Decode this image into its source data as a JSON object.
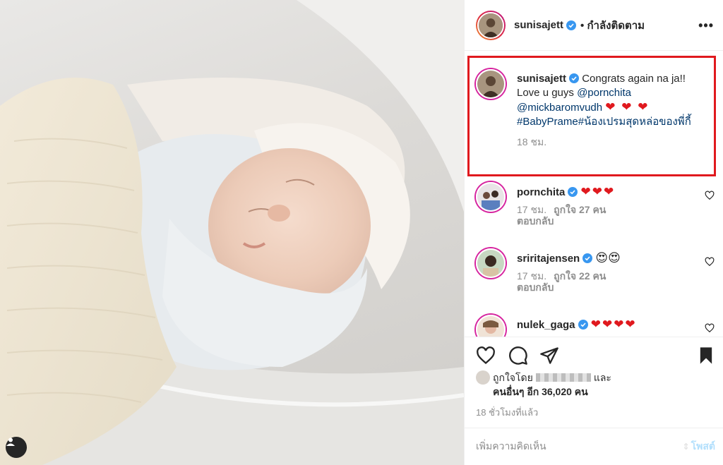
{
  "post_author": {
    "username": "sunisajett",
    "follow_status": "• กำลังติดตาม"
  },
  "caption": {
    "username": "sunisajett",
    "text_plain": "Congrats again na ja!! Love u guys",
    "mention1": "@pornchita",
    "mention2": "@mickbaromvudh",
    "hearts": "❤ ❤ ❤",
    "hashtags": "#BabyPrame#น้องเปรมสุดหล่อของพี่กี้",
    "time": "18 ชม."
  },
  "comments": [
    {
      "username": "pornchita",
      "text": "❤❤❤",
      "time": "17 ชม.",
      "likes": "ถูกใจ 27 คน",
      "reply": "ตอบกลับ"
    },
    {
      "username": "sriritajensen",
      "text": "😍😍",
      "time": "17 ชม.",
      "likes": "ถูกใจ 22 คน",
      "reply": "ตอบกลับ"
    },
    {
      "username": "nulek_gaga",
      "text": "❤❤❤❤"
    }
  ],
  "likes": {
    "prefix": "ถูกใจโดย",
    "and": "และ",
    "others": "คนอื่นๆ อีก 36,020 คน"
  },
  "post_time": "18 ชั่วโมงที่แล้ว",
  "comment_input": {
    "placeholder": "เพิ่มความคิดเห็น",
    "post_label": "โพสต์"
  }
}
